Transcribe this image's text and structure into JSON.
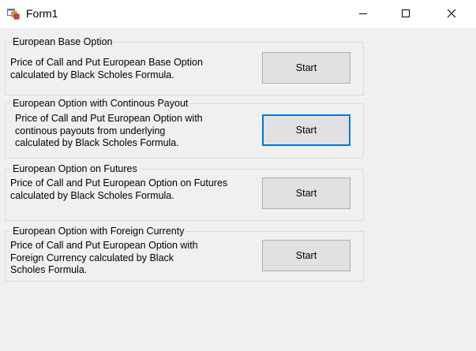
{
  "window": {
    "title": "Form1",
    "icon": "winforms-app-icon",
    "controls": [
      "minimize-icon",
      "maximize-icon",
      "close-icon"
    ]
  },
  "groups": [
    {
      "legend": "European Base Option",
      "description": "Price of Call and Put European Base Option\ncalculated by Black Scholes Formula.",
      "button": "Start"
    },
    {
      "legend": "European Option with Continous Payout",
      "description": "Price of Call and Put European Option with\ncontinous payouts from underlying\ncalculated by Black Scholes Formula.",
      "button": "Start"
    },
    {
      "legend": "European Option on Futures",
      "description": "Price of Call and Put European Option on Futures\ncalculated by Black Scholes Formula.",
      "button": "Start"
    },
    {
      "legend": "European Option with Foreign Currenty",
      "description": "Price of Call and Put European Option with\nForeign Currency calculated by Black\nScholes Formula.",
      "button": "Start"
    }
  ],
  "colors": {
    "title_bar": "#ffffff",
    "form_background": "#f0f0f0",
    "button_face": "#e1e1e1",
    "button_border": "#adadad",
    "focus_border": "#0078d7",
    "group_border": "#dcdcdc"
  }
}
